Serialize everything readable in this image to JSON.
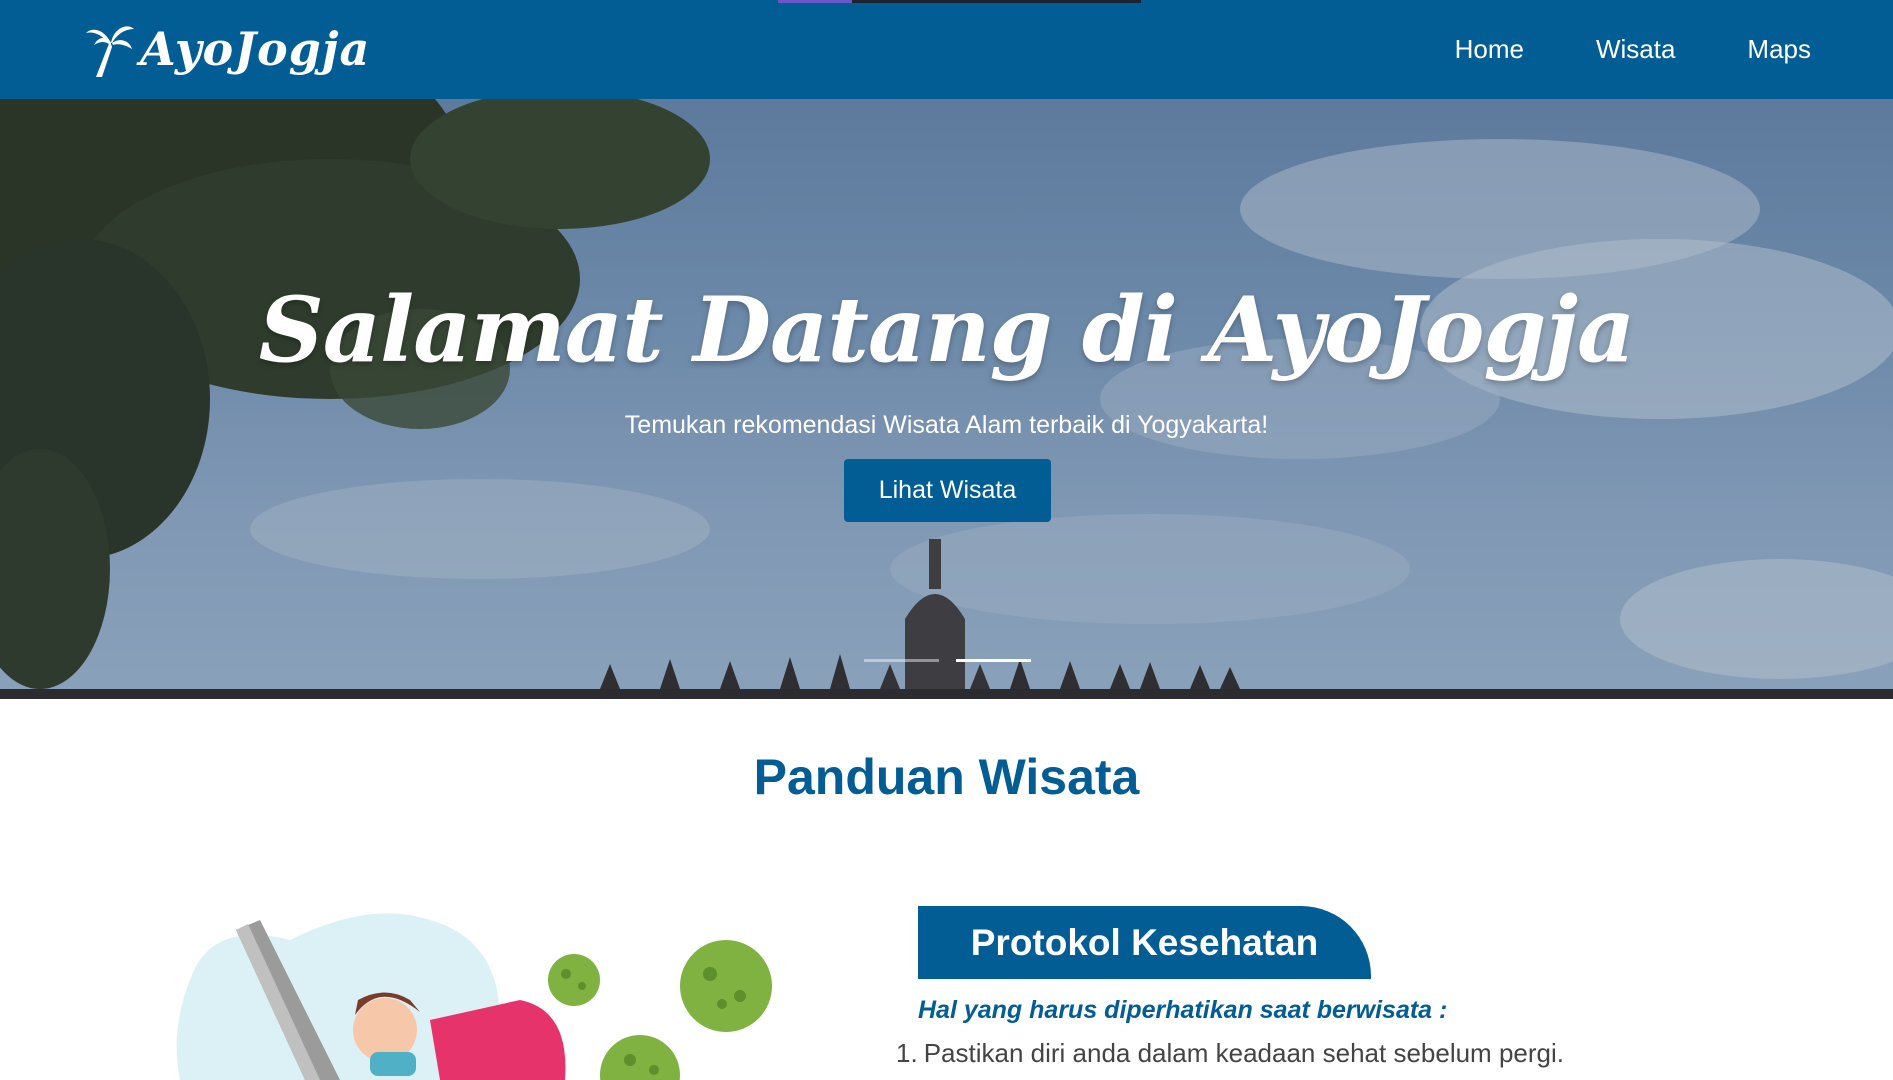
{
  "navbar": {
    "logo_text": "AyoJogja",
    "links": [
      {
        "label": "Home"
      },
      {
        "label": "Wisata"
      },
      {
        "label": "Maps"
      }
    ],
    "colors": {
      "background": "#025d94",
      "text": "#ffffff"
    }
  },
  "hero": {
    "title": "Salamat Datang di AyoJogja",
    "subtitle": "Temukan rekomendasi Wisata Alam terbaik di Yogyakarta!",
    "button_label": "Lihat Wisata",
    "carousel": {
      "slides": 2,
      "active_index": 1
    }
  },
  "guide": {
    "section_title": "Panduan Wisata",
    "illustration": "health-protection-virus-illustration",
    "protocol": {
      "badge": "Protokol Kesehatan",
      "heading": "Hal yang harus diperhatikan saat berwisata :",
      "items": [
        {
          "number": "1.",
          "text": "Pastikan diri anda dalam keadaan sehat sebelum pergi."
        }
      ]
    }
  },
  "colors": {
    "primary": "#025d94",
    "virus": "#7fb241"
  }
}
